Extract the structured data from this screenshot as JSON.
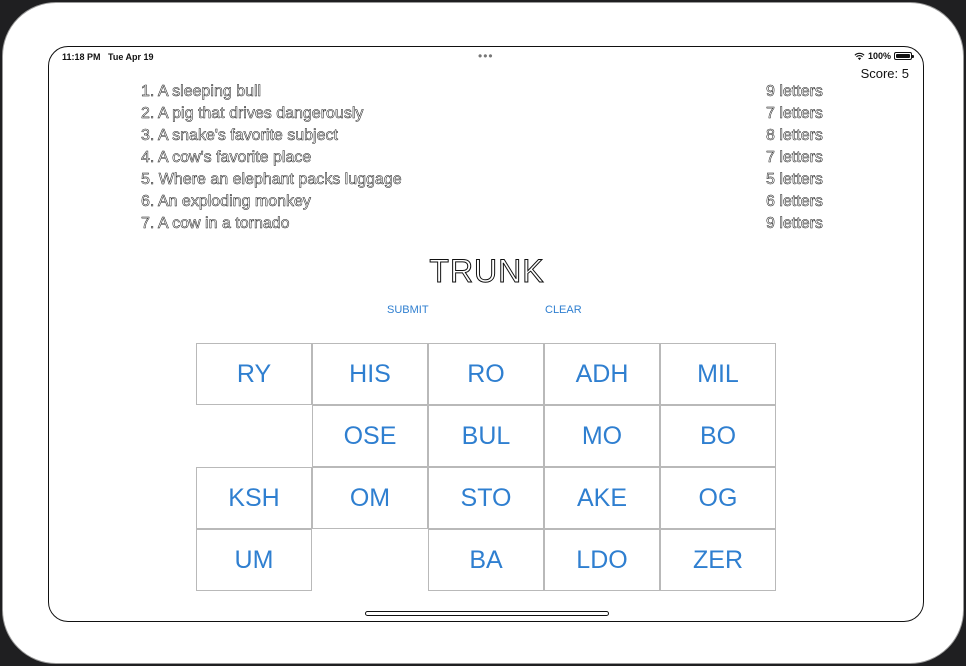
{
  "status": {
    "time": "11:18 PM",
    "date": "Tue Apr 19",
    "battery": "100%",
    "battery_level": 1.0
  },
  "score": {
    "label": "Score:",
    "value": "5"
  },
  "clues": [
    {
      "text": "1. A sleeping bull",
      "length": "9 letters"
    },
    {
      "text": "2. A pig that drives dangerously",
      "length": "7 letters"
    },
    {
      "text": "3. A snake's favorite subject",
      "length": "8 letters"
    },
    {
      "text": "4. A cow's favorite place",
      "length": "7 letters"
    },
    {
      "text": "5. Where an elephant packs luggage",
      "length": "5 letters"
    },
    {
      "text": "6. An exploding monkey",
      "length": "6 letters"
    },
    {
      "text": "7. A cow in a tornado",
      "length": "9 letters"
    }
  ],
  "current_word": "TRUNK",
  "actions": {
    "submit": "SUBMIT",
    "clear": "CLEAR"
  },
  "tiles": [
    [
      "RY",
      "HIS",
      "RO",
      "ADH",
      "MIL"
    ],
    [
      "",
      "OSE",
      "BUL",
      "MO",
      "BO"
    ],
    [
      "KSH",
      "OM",
      "STO",
      "AKE",
      "OG"
    ],
    [
      "UM",
      "",
      "BA",
      "LDO",
      "ZER"
    ]
  ],
  "colors": {
    "accent": "#2f7fd0",
    "tile_border": "#b9b9b9"
  }
}
